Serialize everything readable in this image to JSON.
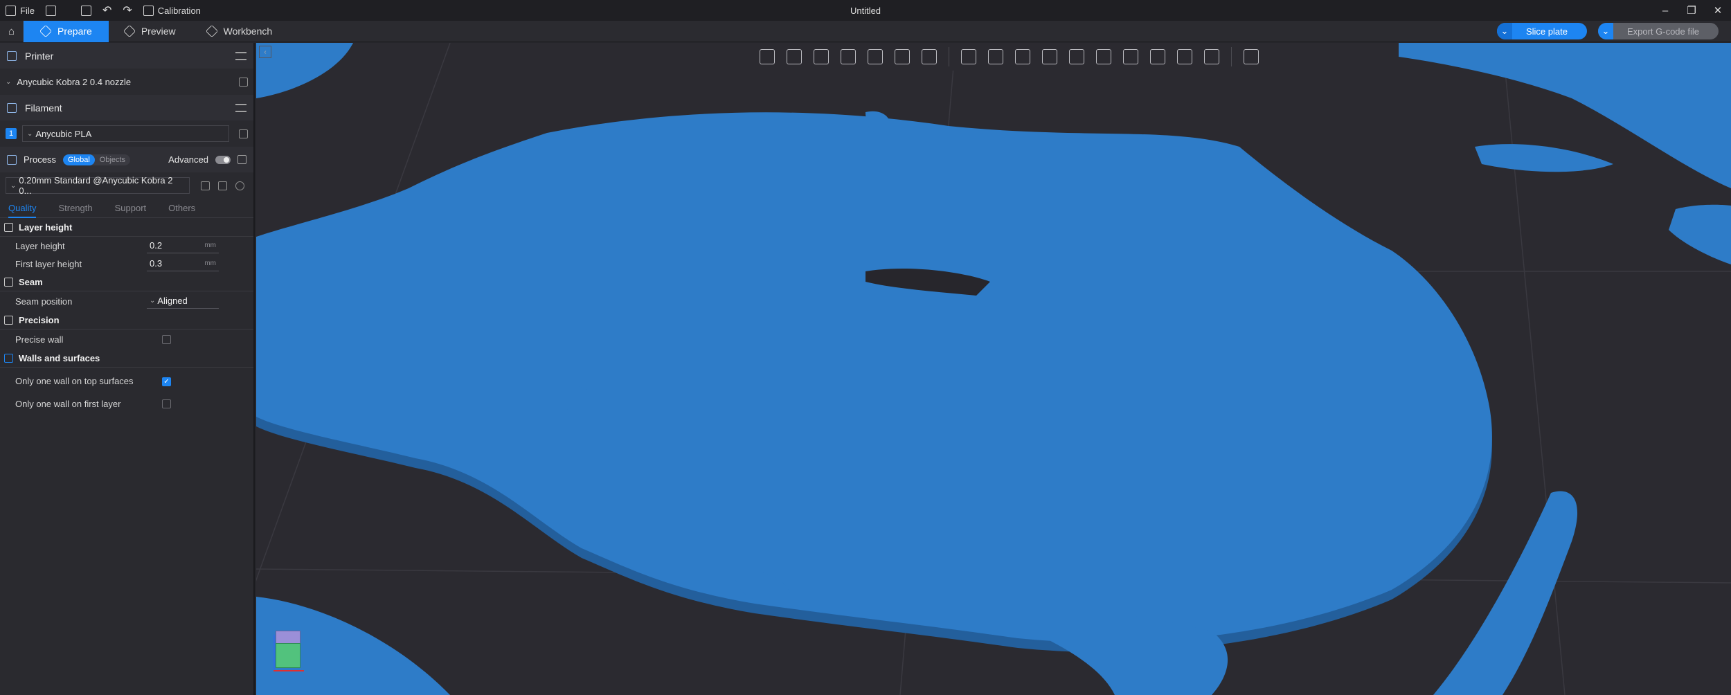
{
  "titlebar": {
    "file_label": "File",
    "calibration_label": "Calibration",
    "window_title": "Untitled"
  },
  "menubar": {
    "tabs": [
      {
        "label": "Prepare"
      },
      {
        "label": "Preview"
      },
      {
        "label": "Workbench"
      }
    ],
    "slice_label": "Slice plate",
    "export_label": "Export G-code file"
  },
  "sidebar": {
    "printer_header": "Printer",
    "printer_value": "Anycubic Kobra 2 0.4 nozzle",
    "filament_header": "Filament",
    "filament_index": "1",
    "filament_value": "Anycubic PLA",
    "process_header": "Process",
    "process_global": "Global",
    "process_objects": "Objects",
    "advanced_label": "Advanced",
    "process_value": "0.20mm Standard @Anycubic Kobra 2 0...",
    "tabs": [
      "Quality",
      "Strength",
      "Support",
      "Others"
    ],
    "groups": {
      "layer_height": "Layer height",
      "seam": "Seam",
      "precision": "Precision",
      "walls": "Walls and surfaces"
    },
    "options": {
      "layer_height_label": "Layer height",
      "layer_height_value": "0.2",
      "layer_height_unit": "mm",
      "first_layer_label": "First layer height",
      "first_layer_value": "0.3",
      "first_layer_unit": "mm",
      "seam_position_label": "Seam position",
      "seam_position_value": "Aligned",
      "precise_wall_label": "Precise wall",
      "one_wall_top_label": "Only one wall on top surfaces",
      "one_wall_first_label": "Only one wall on first layer"
    }
  },
  "colors": {
    "accent": "#1d85f2",
    "model": "#2e7cc8",
    "model_edge": "#235f9c",
    "viewport_bg": "#2b2a30"
  }
}
